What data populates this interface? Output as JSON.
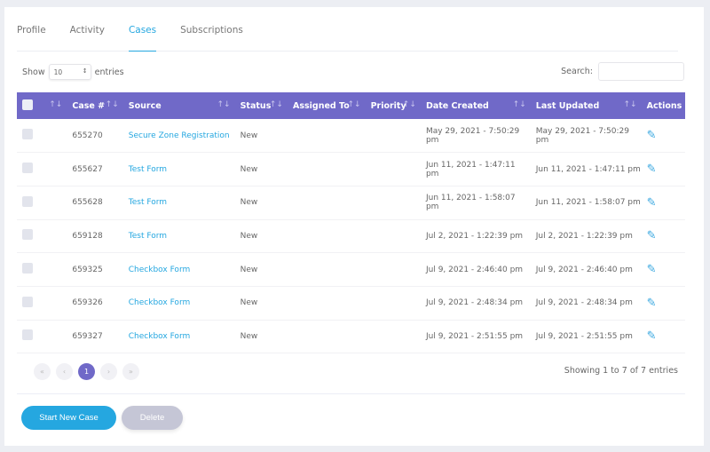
{
  "tabs": [
    "Profile",
    "Activity",
    "Cases",
    "Subscriptions"
  ],
  "active_tab": "Cases",
  "show": {
    "label_before": "Show",
    "value": "10",
    "label_after": "entries"
  },
  "search": {
    "label": "Search:",
    "value": ""
  },
  "columns": [
    "",
    "Case #",
    "Source",
    "Status",
    "Assigned To",
    "Priority",
    "Date Created",
    "Last Updated",
    "Actions"
  ],
  "rows": [
    {
      "case": "655270",
      "source": "Secure Zone Registration",
      "status": "New",
      "assigned": "",
      "priority": "",
      "created": "May 29, 2021 - 7:50:29 pm",
      "updated": "May 29, 2021 - 7:50:29 pm"
    },
    {
      "case": "655627",
      "source": "Test Form",
      "status": "New",
      "assigned": "",
      "priority": "",
      "created": "Jun 11, 2021 - 1:47:11 pm",
      "updated": "Jun 11, 2021 - 1:47:11 pm"
    },
    {
      "case": "655628",
      "source": "Test Form",
      "status": "New",
      "assigned": "",
      "priority": "",
      "created": "Jun 11, 2021 - 1:58:07 pm",
      "updated": "Jun 11, 2021 - 1:58:07 pm"
    },
    {
      "case": "659128",
      "source": "Test Form",
      "status": "New",
      "assigned": "",
      "priority": "",
      "created": "Jul 2, 2021 - 1:22:39 pm",
      "updated": "Jul 2, 2021 - 1:22:39 pm"
    },
    {
      "case": "659325",
      "source": "Checkbox Form",
      "status": "New",
      "assigned": "",
      "priority": "",
      "created": "Jul 9, 2021 - 2:46:40 pm",
      "updated": "Jul 9, 2021 - 2:46:40 pm"
    },
    {
      "case": "659326",
      "source": "Checkbox Form",
      "status": "New",
      "assigned": "",
      "priority": "",
      "created": "Jul 9, 2021 - 2:48:34 pm",
      "updated": "Jul 9, 2021 - 2:48:34 pm"
    },
    {
      "case": "659327",
      "source": "Checkbox Form",
      "status": "New",
      "assigned": "",
      "priority": "",
      "created": "Jul 9, 2021 - 2:51:55 pm",
      "updated": "Jul 9, 2021 - 2:51:55 pm"
    }
  ],
  "pagination": {
    "first": "«",
    "prev": "‹",
    "current": "1",
    "next": "›",
    "last": "»"
  },
  "info": "Showing 1 to 7 of 7 entries",
  "buttons": {
    "start": "Start New Case",
    "delete": "Delete"
  },
  "colors": {
    "header": "#7069c8",
    "accent": "#25a7e0"
  }
}
